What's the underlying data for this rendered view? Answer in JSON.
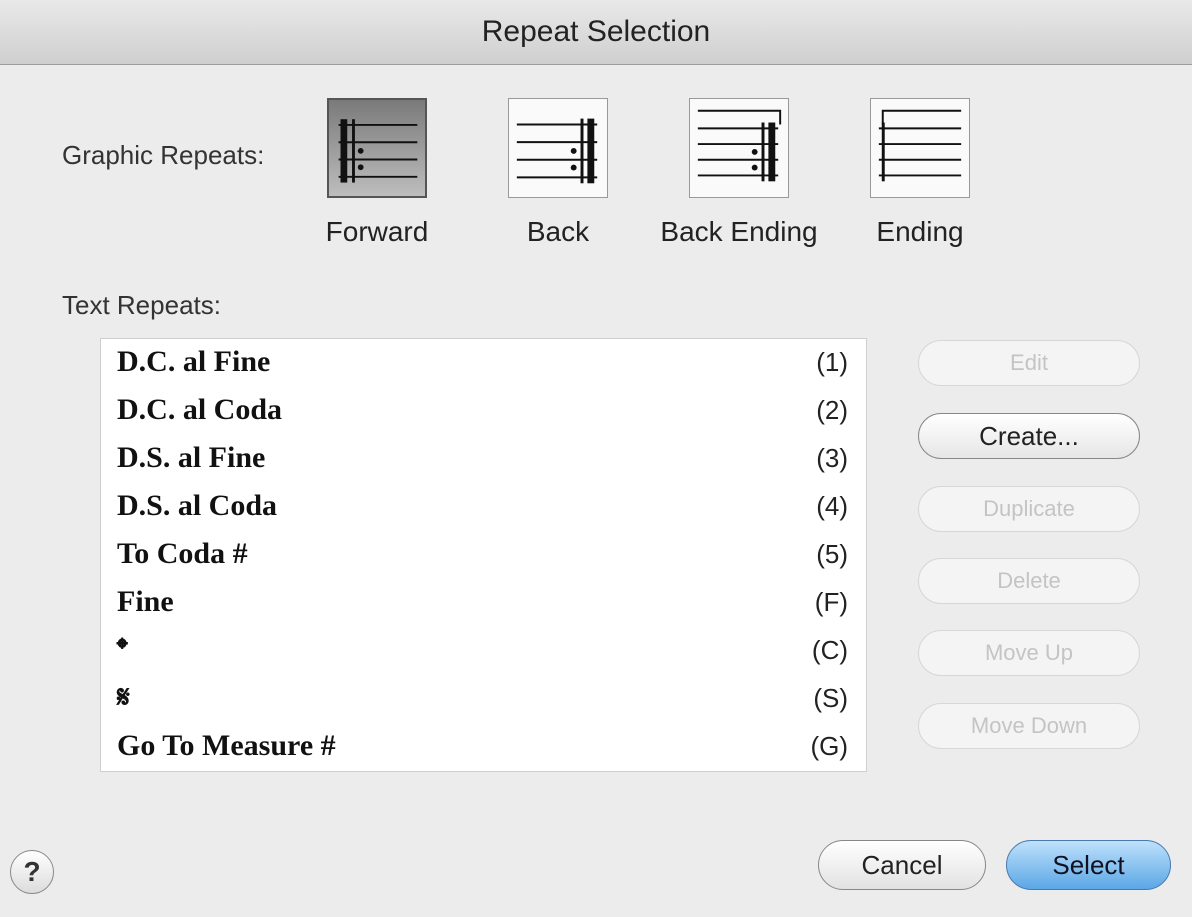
{
  "window": {
    "title": "Repeat Selection"
  },
  "graphic_repeats": {
    "label": "Graphic Repeats:",
    "items": [
      {
        "caption": "Forward",
        "icon": "forward-repeat-icon",
        "selected": true
      },
      {
        "caption": "Back",
        "icon": "back-repeat-icon",
        "selected": false
      },
      {
        "caption": "Back Ending",
        "icon": "back-ending-repeat-icon",
        "selected": false
      },
      {
        "caption": "Ending",
        "icon": "ending-repeat-icon",
        "selected": false
      }
    ]
  },
  "text_repeats": {
    "label": "Text Repeats:",
    "items": [
      {
        "name": "D.C. al Fine",
        "key": "(1)"
      },
      {
        "name": "D.C. al Coda",
        "key": "(2)"
      },
      {
        "name": "D.S. al Fine",
        "key": "(3)"
      },
      {
        "name": "D.S. al Coda",
        "key": "(4)"
      },
      {
        "name": "To Coda #",
        "key": "(5)"
      },
      {
        "name": "Fine",
        "key": "(F)"
      },
      {
        "name": "𝄌",
        "key": "(C)"
      },
      {
        "name": "𝄋",
        "key": "(S)"
      },
      {
        "name": "Go To Measure #",
        "key": "(G)"
      }
    ]
  },
  "side_buttons": [
    {
      "label": "Edit",
      "enabled": false
    },
    {
      "label": "Create...",
      "enabled": true
    },
    {
      "label": "Duplicate",
      "enabled": false
    },
    {
      "label": "Delete",
      "enabled": false
    },
    {
      "label": "Move Up",
      "enabled": false
    },
    {
      "label": "Move Down",
      "enabled": false
    }
  ],
  "footer": {
    "help": "?",
    "cancel": "Cancel",
    "select": "Select"
  }
}
